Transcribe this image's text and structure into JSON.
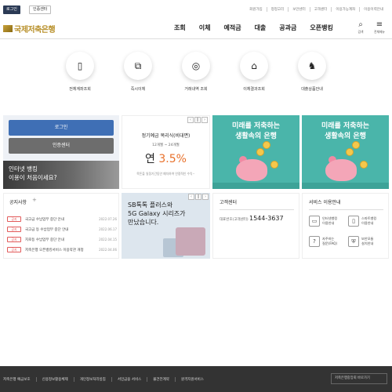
{
  "top": {
    "login": "로그인",
    "cert": "인증센터",
    "utils": [
      "회원가입",
      "청정고리",
      "보안센터",
      "고객센터",
      "이용가능계좌",
      "이용이력안내"
    ]
  },
  "header": {
    "logo": "국제저축은행",
    "menu": [
      "조회",
      "이체",
      "예적금",
      "대출",
      "공과금",
      "오픈뱅킹"
    ],
    "icons": [
      {
        "icon": "search-icon",
        "glyph": "⌕",
        "label": "검색"
      },
      {
        "icon": "menu-icon",
        "glyph": "≡",
        "label": "전체메뉴"
      }
    ]
  },
  "quick": [
    {
      "label": "전체계좌조회",
      "glyph": "▯"
    },
    {
      "label": "즉시이체",
      "glyph": "⧉"
    },
    {
      "label": "거래내역 조회",
      "glyph": "◎"
    },
    {
      "label": "이체결과조회",
      "glyph": "⌂"
    },
    {
      "label": "대출상품안내",
      "glyph": "♞"
    }
  ],
  "login_card": {
    "login_button": "로그인",
    "cert_button": "인증센터",
    "banner_text": "인터넷 뱅킹\n이용이 처음이세요?"
  },
  "deposit": {
    "title": "정기예금 복리식(비대면)",
    "period": "12개월 ~ 24개월",
    "rate_prefix": "연 ",
    "rate": "3.5%",
    "note": "목돈을 일정기간동안 예치하여 안정적인 수익~",
    "nav_prev": "‹",
    "nav_pause": "‖",
    "nav_next": "›"
  },
  "saving_banner": {
    "text": "미래를 저축하는\n생활속의 은행"
  },
  "notice": {
    "title": "공지사항",
    "more": "+",
    "items": [
      {
        "tag": "공지",
        "title": "국고금 수납업무 중단 안내",
        "date": "2022.07.26"
      },
      {
        "tag": "공지",
        "title": "국고금 등 수납업무 중단 안내",
        "date": "2022.06.17"
      },
      {
        "tag": "공지",
        "title": "지로등 수납업무 중단 안내",
        "date": "2022.04.15"
      },
      {
        "tag": "공지",
        "title": "저축은행 오픈뱅킹서비스 이용약관 개정",
        "date": "2022.04.06"
      }
    ]
  },
  "promo": {
    "text": "SB톡톡 플러스와\n5G Galaxy 시리즈가\n만났습니다.",
    "nav_prev": "‹",
    "nav_pause": "‖",
    "nav_next": "›"
  },
  "cs": {
    "title": "고객센터",
    "label": "대표번호(고객센터)",
    "phone": "1544-3637"
  },
  "service": {
    "title": "서비스 이용안내",
    "items": [
      {
        "icon": "desktop-icon",
        "glyph": "▭",
        "label": "인터넷뱅킹\n이용안내"
      },
      {
        "icon": "mobile-icon",
        "glyph": "▯",
        "label": "스마트뱅킹\n이용안내"
      },
      {
        "icon": "faq-icon",
        "glyph": "?",
        "label": "자주하는\n질문(FAQ)"
      },
      {
        "icon": "shield-icon",
        "glyph": "⛨",
        "label": "보안모듈\n설치안내"
      }
    ]
  },
  "footer": {
    "links": [
      "저축은행 예금보호",
      "신용정보활용체제",
      "개인정보처리방침",
      "서민금융 서비스",
      "불건전계약",
      "원격지원서비스"
    ],
    "family": "저축은행중앙회 바로가기"
  }
}
